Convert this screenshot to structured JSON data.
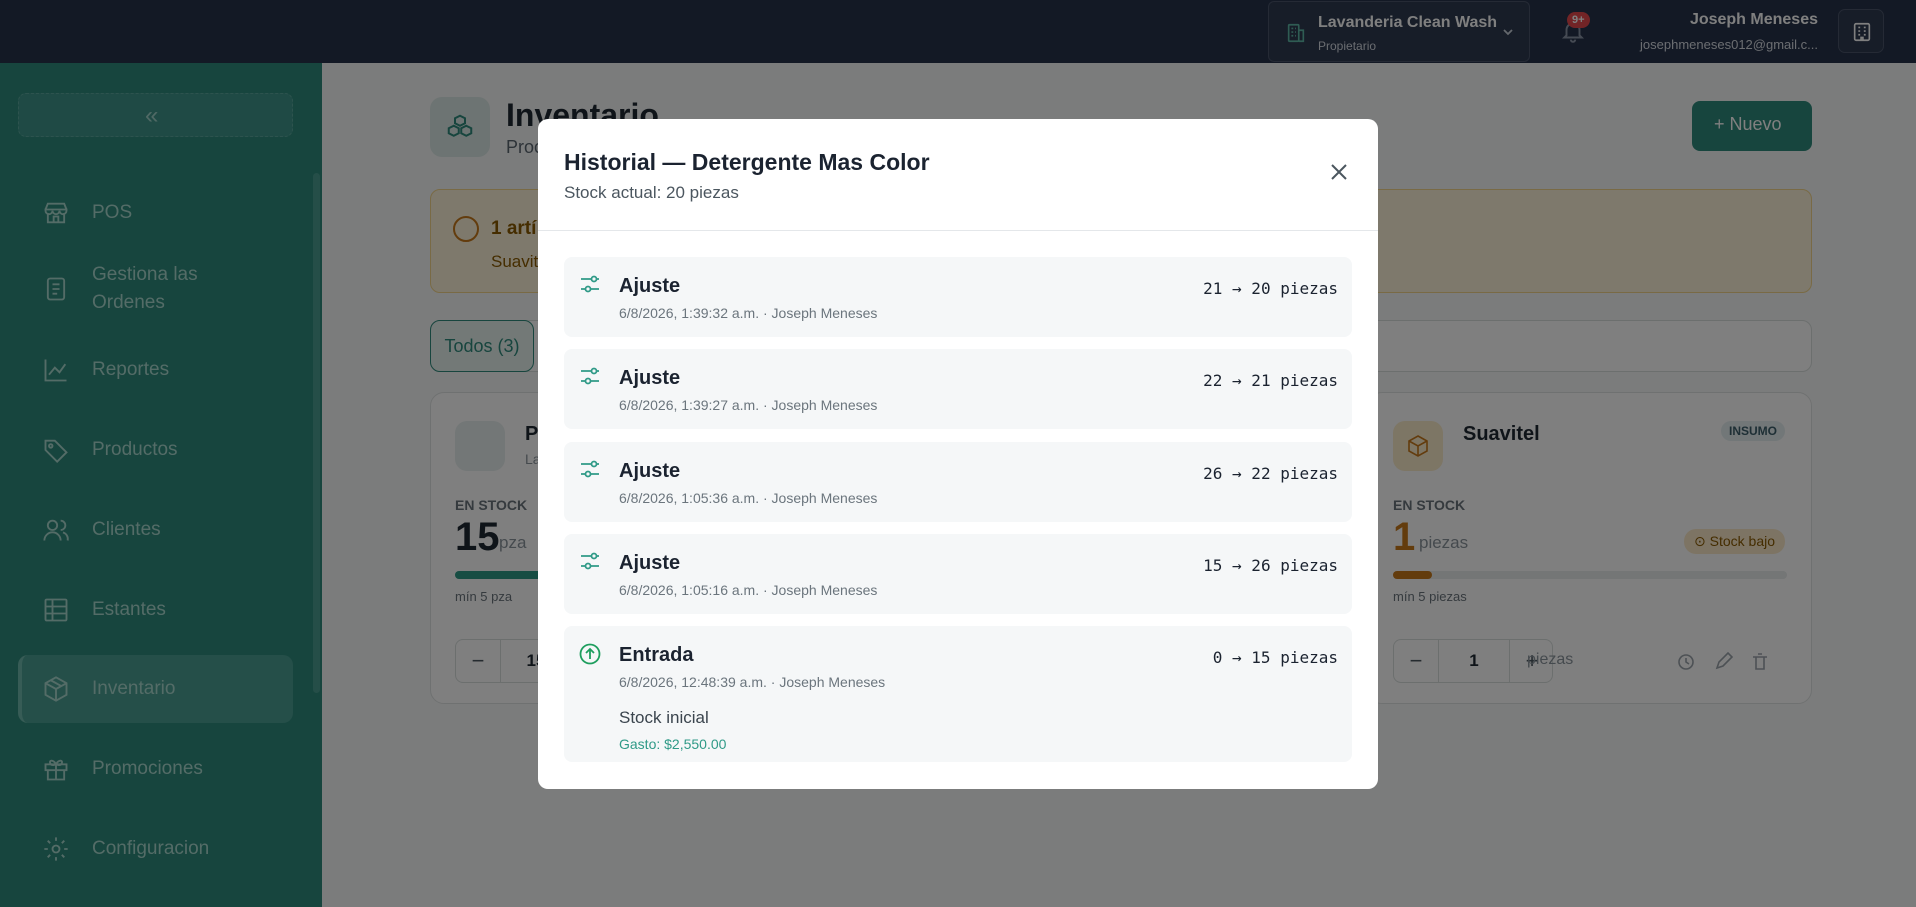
{
  "topbar": {
    "org_name": "Lavanderia Clean Wash",
    "org_role": "Propietario",
    "notif_badge": "9+",
    "user_name": "Joseph Meneses",
    "user_email": "josephmeneses012@gmail.c..."
  },
  "sidebar": {
    "collapse_glyph": "«",
    "items": [
      {
        "label": "POS",
        "icon": "store-icon"
      },
      {
        "label": "Gestiona las Ordenes",
        "icon": "clipboard-icon"
      },
      {
        "label": "Reportes",
        "icon": "chart-line-icon"
      },
      {
        "label": "Productos",
        "icon": "tag-icon"
      },
      {
        "label": "Clientes",
        "icon": "users-icon"
      },
      {
        "label": "Estantes",
        "icon": "shelves-icon"
      },
      {
        "label": "Inventario",
        "icon": "box-icon",
        "active": true
      },
      {
        "label": "Promociones",
        "icon": "gift-icon"
      },
      {
        "label": "Configuracion",
        "icon": "gear-icon"
      }
    ]
  },
  "page": {
    "title": "Inventario",
    "subtitle": "Proc",
    "new_button": "+ Nuevo",
    "alert_title": "1 artí",
    "alert_sub": "Suavit",
    "filter_chip": "Todos (3)"
  },
  "cards": {
    "left": {
      "name": "Pa",
      "sub": "Lav",
      "stock_label": "EN STOCK",
      "stock_value": "15",
      "unit": "pza",
      "min_label": "mín 5 pza",
      "qty": "15",
      "fill_fraction": 0.2
    },
    "right": {
      "name": "Suavitel",
      "tag": "INSUMO",
      "stock_label": "EN STOCK",
      "stock_value": "1",
      "unit": "piezas",
      "low_badge": "Stock bajo",
      "min_label": "mín 5 piezas",
      "qty": "1",
      "qty_unit": "piezas",
      "fill_fraction": 0.1
    }
  },
  "modal": {
    "title": "Historial — Detergente Mas Color",
    "stock": "Stock actual: 20 piezas",
    "entries": [
      {
        "type": "Ajuste",
        "meta": "6/8/2026, 1:39:32 a.m. · Joseph Meneses",
        "change": "21 → 20 piezas",
        "icon": "sliders-icon"
      },
      {
        "type": "Ajuste",
        "meta": "6/8/2026, 1:39:27 a.m. · Joseph Meneses",
        "change": "22 → 21 piezas",
        "icon": "sliders-icon"
      },
      {
        "type": "Ajuste",
        "meta": "6/8/2026, 1:05:36 a.m. · Joseph Meneses",
        "change": "26 → 22 piezas",
        "icon": "sliders-icon"
      },
      {
        "type": "Ajuste",
        "meta": "6/8/2026, 1:05:16 a.m. · Joseph Meneses",
        "change": "15 → 26 piezas",
        "icon": "sliders-icon"
      },
      {
        "type": "Entrada",
        "meta": "6/8/2026, 12:48:39 a.m. · Joseph Meneses",
        "change": "0 → 15 piezas",
        "note": "Stock inicial",
        "cost": "Gasto: $2,550.00",
        "icon": "arrow-up-circle-icon"
      }
    ]
  },
  "colors": {
    "sidebar": "#2f8a7c",
    "topbar": "#27334a",
    "accent": "#2f9a87",
    "warning": "#c7791b"
  }
}
